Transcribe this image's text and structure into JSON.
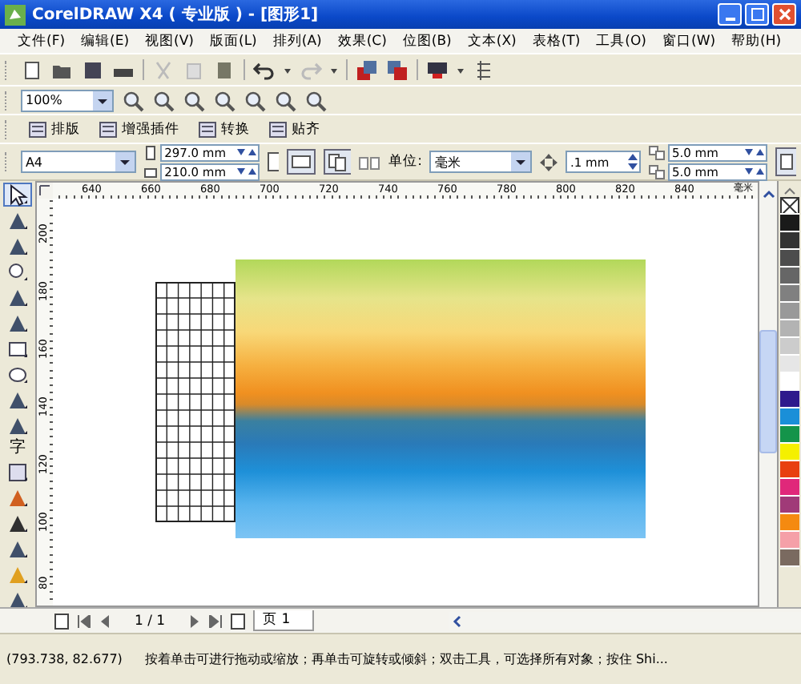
{
  "window": {
    "title": "CorelDRAW X4 ( 专业版 ) - [图形1]"
  },
  "menu": [
    {
      "label": "文件(F)"
    },
    {
      "label": "编辑(E)"
    },
    {
      "label": "视图(V)"
    },
    {
      "label": "版面(L)"
    },
    {
      "label": "排列(A)"
    },
    {
      "label": "效果(C)"
    },
    {
      "label": "位图(B)"
    },
    {
      "label": "文本(X)"
    },
    {
      "label": "表格(T)"
    },
    {
      "label": "工具(O)"
    },
    {
      "label": "窗口(W)"
    },
    {
      "label": "帮助(H)"
    }
  ],
  "zoom": {
    "value": "100%"
  },
  "plugin_bar": [
    {
      "label": "排版"
    },
    {
      "label": "增强插件"
    },
    {
      "label": "转换"
    },
    {
      "label": "贴齐"
    }
  ],
  "property_bar": {
    "paper": "A4",
    "width": "297.0 mm",
    "height": "210.0 mm",
    "unit_label": "单位:",
    "unit": "毫米",
    "nudge": ".1 mm",
    "dup_x": "5.0 mm",
    "dup_y": "5.0 mm"
  },
  "ruler_h": [
    "640",
    "660",
    "680",
    "700",
    "720",
    "740",
    "760",
    "780",
    "800",
    "820",
    "840"
  ],
  "ruler_unit": "毫米",
  "ruler_v": [
    "200",
    "180",
    "160",
    "140",
    "120",
    "100",
    "80"
  ],
  "toolbox": [
    {
      "kind": "pick",
      "selected": true
    },
    {
      "kind": "shape",
      "selected": false
    },
    {
      "kind": "crop",
      "selected": false
    },
    {
      "kind": "zoom",
      "selected": false
    },
    {
      "kind": "freehand",
      "selected": false
    },
    {
      "kind": "smart",
      "selected": false
    },
    {
      "kind": "rect",
      "selected": false
    },
    {
      "kind": "ellipse",
      "selected": false
    },
    {
      "kind": "polygon",
      "selected": false
    },
    {
      "kind": "basic",
      "selected": false
    },
    {
      "kind": "text",
      "label": "字",
      "selected": false
    },
    {
      "kind": "table",
      "selected": false
    },
    {
      "kind": "blend",
      "selected": false
    },
    {
      "kind": "eyedropper",
      "selected": false
    },
    {
      "kind": "outline",
      "selected": false
    },
    {
      "kind": "fill",
      "selected": false
    },
    {
      "kind": "interactive",
      "selected": false
    }
  ],
  "palette": [
    {
      "color": "#ffffff",
      "kind": "none"
    },
    {
      "color": "#1a1a1a"
    },
    {
      "color": "#333333"
    },
    {
      "color": "#4d4d4d"
    },
    {
      "color": "#666666"
    },
    {
      "color": "#808080"
    },
    {
      "color": "#999999"
    },
    {
      "color": "#b3b3b3"
    },
    {
      "color": "#cccccc"
    },
    {
      "color": "#e6e6e6"
    },
    {
      "color": "#ffffff"
    },
    {
      "color": "#2e1a8c"
    },
    {
      "color": "#1a8fd8"
    },
    {
      "color": "#14944a"
    },
    {
      "color": "#f5f000"
    },
    {
      "color": "#e84010"
    },
    {
      "color": "#e0287a"
    },
    {
      "color": "#a03a78"
    },
    {
      "color": "#f58a10"
    },
    {
      "color": "#f5a0a8"
    },
    {
      "color": "#7a6a60"
    }
  ],
  "page_nav": {
    "count": "1 / 1",
    "tab": "页 1"
  },
  "status_bar": {
    "coords": "(793.738, 82.677)",
    "message": "按着单击可进行拖动或缩放；再单击可旋转或倾斜；双击工具，可选择所有对象；按住 Shi..."
  }
}
